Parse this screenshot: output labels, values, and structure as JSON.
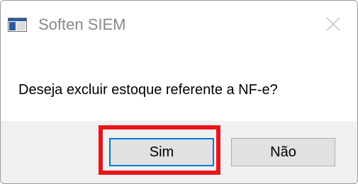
{
  "window": {
    "title": "Soften SIEM"
  },
  "dialog": {
    "message": "Deseja excluir estoque referente a NF-e?",
    "buttons": {
      "yes_label": "Sim",
      "no_label": "Não"
    }
  },
  "icons": {
    "app": "app-window-icon",
    "close": "close-icon"
  },
  "colors": {
    "highlight": "#e8151b",
    "focus_border": "#0078d7",
    "footer_bg": "#f0f0f0",
    "title_text": "#8a8a8a"
  }
}
